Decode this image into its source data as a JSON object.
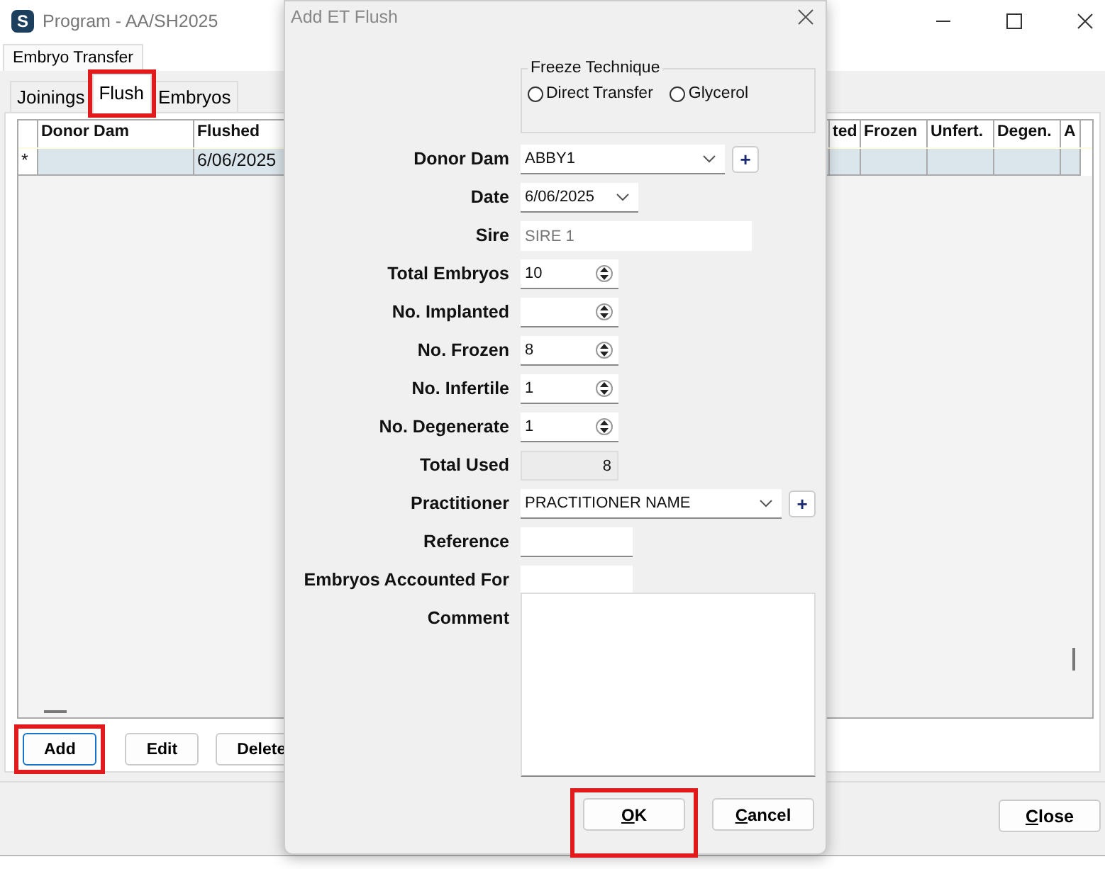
{
  "main_window": {
    "logo_letter": "S",
    "title": "Program - AA/SH2025",
    "outer_tabs": [
      {
        "label": "Embryo Transfer",
        "selected": true
      }
    ],
    "tabs": [
      {
        "label": "Joinings",
        "selected": false,
        "highlighted": false
      },
      {
        "label": "Flush",
        "selected": true,
        "highlighted": true
      },
      {
        "label": "Embryos",
        "selected": false,
        "highlighted": false
      }
    ],
    "table": {
      "columns": [
        "",
        "Donor Dam",
        "Flushed",
        "ted",
        "Frozen",
        "Unfert.",
        "Degen.",
        "A"
      ],
      "rows": [
        {
          "cells": [
            "*",
            "",
            "6/06/2025",
            "",
            "",
            "",
            "",
            ""
          ],
          "selected": true
        }
      ]
    },
    "buttons": [
      {
        "label": "Add",
        "highlighted": true,
        "focused": true
      },
      {
        "label": "Edit",
        "highlighted": false,
        "focused": false
      },
      {
        "label": "Delete",
        "highlighted": false,
        "focused": false
      }
    ],
    "close_button": "Close"
  },
  "dialog": {
    "title": "Add ET Flush",
    "freeze_technique": {
      "title": "Freeze Technique",
      "options": [
        {
          "label": "Direct Transfer",
          "selected": false
        },
        {
          "label": "Glycerol",
          "selected": false
        }
      ]
    },
    "fields": [
      {
        "label": "Donor Dam",
        "kind": "combo",
        "value": "ABBY1",
        "add_button": "+"
      },
      {
        "label": "Date",
        "kind": "date",
        "value": "6/06/2025"
      },
      {
        "label": "Sire",
        "kind": "readonly_text",
        "value": "SIRE 1",
        "disabled": true
      },
      {
        "label": "Total Embryos",
        "kind": "spin",
        "value": "10"
      },
      {
        "label": "No. Implanted",
        "kind": "spin"
      },
      {
        "label": "No. Frozen",
        "kind": "spin",
        "value": "8"
      },
      {
        "label": "No. Infertile",
        "kind": "spin",
        "value": "1"
      },
      {
        "label": "No. Degenerate",
        "kind": "spin",
        "value": "1"
      },
      {
        "label": "Total Used",
        "kind": "readonly_number",
        "value": "8"
      },
      {
        "label": "Practitioner",
        "kind": "combo_wide",
        "value": "PRACTITIONER NAME",
        "add_button": "+"
      },
      {
        "label": "Reference",
        "kind": "text"
      },
      {
        "label": "Embryos Accounted For",
        "kind": "text"
      },
      {
        "label": "Comment",
        "kind": "textarea"
      }
    ],
    "buttons": [
      {
        "label": "OK",
        "highlighted": true
      },
      {
        "label": "Cancel",
        "highlighted": false
      }
    ]
  }
}
